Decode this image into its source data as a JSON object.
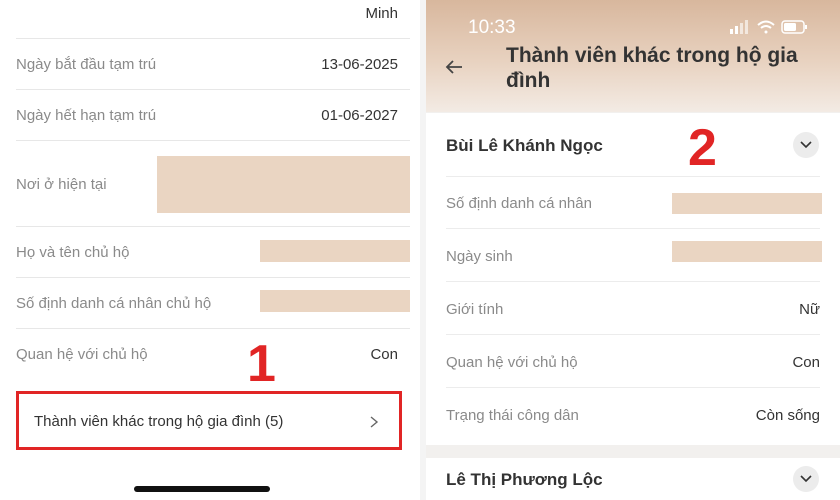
{
  "left_panel": {
    "top_value": "Minh",
    "rows": [
      {
        "label": "Ngày bắt đầu tạm trú",
        "value": "13-06-2025"
      },
      {
        "label": "Ngày hết hạn tạm trú",
        "value": "01-06-2027"
      },
      {
        "label": "Nơi ở hiện tại",
        "value": ""
      },
      {
        "label": "Họ và tên chủ hộ",
        "value": ""
      },
      {
        "label": "Số định danh cá nhân chủ hộ",
        "value": ""
      },
      {
        "label": "Quan hệ với chủ hộ",
        "value": "Con"
      }
    ],
    "members_button": "Thành viên khác trong hộ gia đình (5)",
    "step_label": "1"
  },
  "right_panel": {
    "status_time": "10:33",
    "title": "Thành viên khác trong hộ gia đình",
    "step_label": "2",
    "members": [
      {
        "name": "Bùi Lê Khánh Ngọc",
        "rows": [
          {
            "label": "Số định danh cá nhân",
            "value": ""
          },
          {
            "label": "Ngày sinh",
            "value": ""
          },
          {
            "label": "Giới tính",
            "value": "Nữ"
          },
          {
            "label": "Quan hệ với chủ hộ",
            "value": "Con"
          },
          {
            "label": "Trạng thái công dân",
            "value": "Còn sống"
          }
        ]
      },
      {
        "name": "Lê Thị Phương Lộc"
      }
    ]
  },
  "colors": {
    "highlight": "#e12525",
    "redaction": "#ead5c2",
    "header_gradient_top": "#d8b79d"
  },
  "icons": [
    "chevron-right-icon",
    "back-arrow-icon",
    "chevron-down-icon",
    "signal-icon",
    "wifi-icon",
    "battery-icon"
  ]
}
